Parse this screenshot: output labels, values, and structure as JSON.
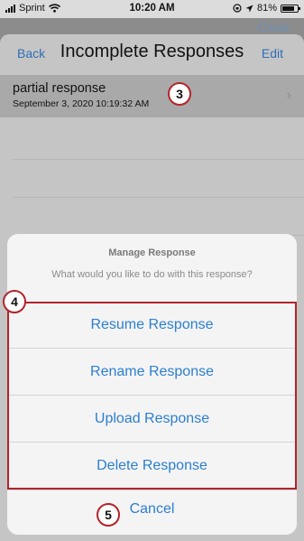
{
  "status": {
    "carrier": "Sprint",
    "time": "10:20 AM",
    "battery": "81%"
  },
  "header": {
    "close_label": "Close",
    "back_label": "Back",
    "title": "Incomplete Responses",
    "edit_label": "Edit"
  },
  "list": {
    "items": [
      {
        "title": "partial response",
        "timestamp": "September 3, 2020 10:19:32 AM"
      }
    ]
  },
  "action_sheet": {
    "title": "Manage Response",
    "message": "What would you like to do with this response?",
    "actions": [
      {
        "label": "Resume Response"
      },
      {
        "label": "Rename Response"
      },
      {
        "label": "Upload Response"
      },
      {
        "label": "Delete Response"
      }
    ],
    "cancel_label": "Cancel"
  },
  "callouts": [
    "3",
    "4",
    "5"
  ],
  "colors": {
    "accent": "#2b7fd0",
    "callout_border": "#b3252b"
  }
}
